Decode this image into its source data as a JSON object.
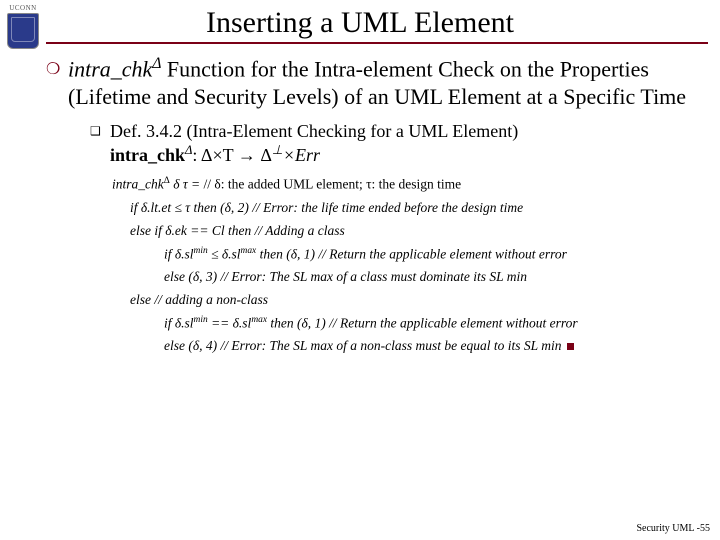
{
  "logo": {
    "text": "UCONN"
  },
  "title": "Inserting a UML Element",
  "main_bullet": {
    "pre_italic": "intra_chk",
    "sup": "Δ",
    "rest": " Function for the Intra-element Check on the Properties (Lifetime and Security Levels) of an UML Element at a Specific Time"
  },
  "sub_bullet": {
    "line1": "Def. 3.4.2 (Intra-Element Checking for a UML Element)",
    "line2_bold": "intra_chk",
    "line2_sup": "Δ",
    "line2_rest": ": Δ×T → Δ",
    "line2_perp": "⊥",
    "line2_err": "×Err"
  },
  "code": {
    "l1a": "intra_chk",
    "l1sup": "Δ",
    "l1b": " δ τ = ",
    "l1c": "// δ: the added UML element;  τ: the design time",
    "l2": "if  δ.lt.et ≤  τ  then (δ, 2) // Error: the life time ended before the design time",
    "l3": "else if  δ.ek == Cl then // Adding a class",
    "l4a": "if  δ.sl",
    "l4min": "min",
    "l4b": " ≤  δ.sl",
    "l4max": "max",
    "l4c": " then (δ, 1) // Return the applicable element without error",
    "l5": "else (δ, 3) // Error: The SL max of a class must dominate its SL min",
    "l6": "else // adding a non-class",
    "l7a": "if  δ.sl",
    "l7min": "min",
    "l7b": " ==  δ.sl",
    "l7max": "max",
    "l7c": " then (δ, 1) // Return the applicable element without error",
    "l8": "else (δ, 4) // Error: The SL max of a non-class must be equal to its SL min"
  },
  "footer": "Security UML -55"
}
